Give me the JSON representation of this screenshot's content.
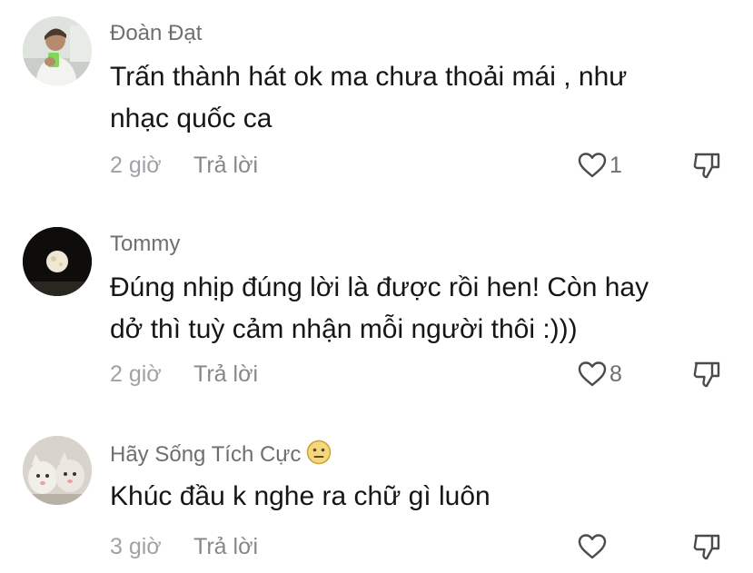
{
  "comments": [
    {
      "username": "Đoàn Đạt",
      "text": "Trấn thành hát ok ma chưa thoải mái , như\nnhạc quốc ca",
      "time": "2 giờ",
      "reply_label": "Trả lời",
      "likes": "1",
      "avatar_icon": "user-photo"
    },
    {
      "username": "Tommy",
      "text": "Đúng nhịp đúng lời là được rồi hen! Còn hay\ndở thì tuỳ cảm nhận mỗi người thôi :)))",
      "time": "2 giờ",
      "reply_label": "Trả lời",
      "likes": "8",
      "avatar_icon": "moon-photo"
    },
    {
      "username": "Hãy Sống Tích Cực",
      "username_emoji": "neutral-face-emoji",
      "text": "Khúc đầu k nghe ra chữ gì luôn",
      "time": "3 giờ",
      "reply_label": "Trả lời",
      "likes": "",
      "avatar_icon": "cats-photo"
    }
  ],
  "colors": {
    "username": "#6e6e73",
    "text": "#161616",
    "meta": "#a1a1a6",
    "icon": "#4a4a4f"
  }
}
